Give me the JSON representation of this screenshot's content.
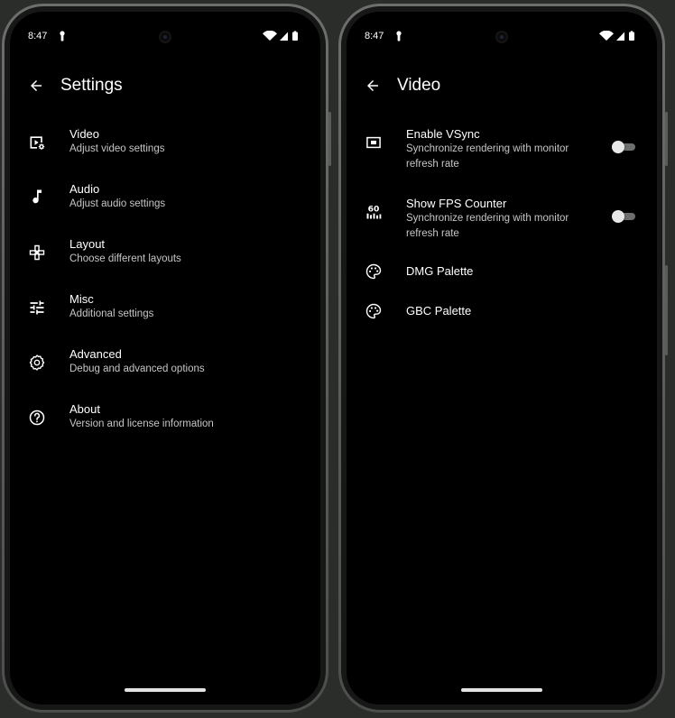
{
  "status_bar": {
    "time": "8:47"
  },
  "left_screen": {
    "title": "Settings",
    "items": [
      {
        "label": "Video",
        "sub": "Adjust video settings",
        "icon": "video-settings-icon"
      },
      {
        "label": "Audio",
        "sub": "Adjust audio settings",
        "icon": "music-note-icon"
      },
      {
        "label": "Layout",
        "sub": "Choose different layouts",
        "icon": "gamepad-icon"
      },
      {
        "label": "Misc",
        "sub": "Additional settings",
        "icon": "tune-sliders-icon"
      },
      {
        "label": "Advanced",
        "sub": "Debug and advanced options",
        "icon": "gear-icon"
      },
      {
        "label": "About",
        "sub": "Version and license information",
        "icon": "help-circle-icon"
      }
    ]
  },
  "right_screen": {
    "title": "Video",
    "vsync": {
      "label": "Enable VSync",
      "sub1": "Synchronize rendering with monitor",
      "sub2": "refresh rate",
      "icon": "display-icon",
      "enabled": false
    },
    "fps": {
      "label": "Show FPS Counter",
      "sub1": "Synchronize rendering with monitor",
      "sub2": "refresh rate",
      "icon": "fps-60-icon",
      "icon_text": "60",
      "enabled": false
    },
    "dmg": {
      "label": "DMG Palette",
      "icon": "palette-icon"
    },
    "gbc": {
      "label": "GBC Palette",
      "icon": "palette-icon"
    }
  },
  "colors": {
    "background": "#000000",
    "text": "#ffffff",
    "subtext": "#c4c7c5",
    "switch_track": "#6c6f6e",
    "switch_thumb": "#e8e8e8"
  }
}
